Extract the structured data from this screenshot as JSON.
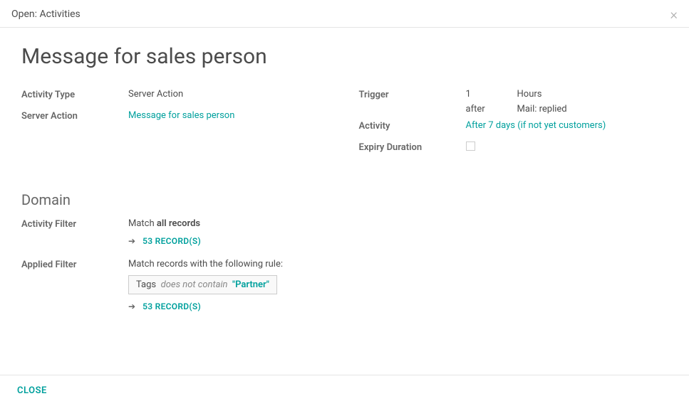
{
  "modal": {
    "title": "Open: Activities",
    "close_label": "CLOSE"
  },
  "page": {
    "title": "Message for sales person"
  },
  "left_fields": {
    "activity_type": {
      "label": "Activity Type",
      "value": "Server Action"
    },
    "server_action": {
      "label": "Server Action",
      "value": "Message for sales person"
    }
  },
  "right_fields": {
    "trigger": {
      "label": "Trigger",
      "amount": "1",
      "unit": "Hours",
      "relation": "after",
      "event": "Mail: replied"
    },
    "activity": {
      "label": "Activity",
      "value": "After 7 days (if not yet customers)"
    },
    "expiry": {
      "label": "Expiry Duration",
      "checked": false
    }
  },
  "domain": {
    "heading": "Domain",
    "activity_filter": {
      "label": "Activity Filter",
      "match_prefix": "Match ",
      "match_bold": "all records",
      "records_link": "53 RECORD(S)"
    },
    "applied_filter": {
      "label": "Applied Filter",
      "match_text": "Match records with the following rule:",
      "rule": {
        "field": "Tags",
        "op": "does not contain",
        "value": "\"Partner\""
      },
      "records_link": "53 RECORD(S)"
    }
  }
}
